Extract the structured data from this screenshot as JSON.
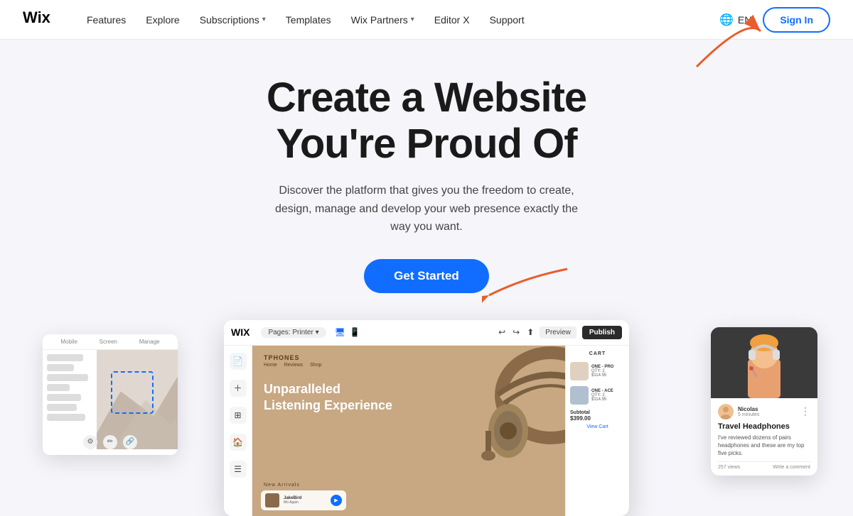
{
  "nav": {
    "logo_text": "Wix",
    "links": [
      {
        "label": "Features",
        "has_dropdown": false
      },
      {
        "label": "Explore",
        "has_dropdown": false
      },
      {
        "label": "Subscriptions",
        "has_dropdown": true
      },
      {
        "label": "Templates",
        "has_dropdown": false
      },
      {
        "label": "Wix Partners",
        "has_dropdown": true
      },
      {
        "label": "Editor X",
        "has_dropdown": false
      },
      {
        "label": "Support",
        "has_dropdown": false
      }
    ],
    "lang": "EN",
    "signin_label": "Sign In"
  },
  "hero": {
    "title_line1": "Create a Website",
    "title_line2": "You're Proud Of",
    "subtitle": "Discover the platform that gives you the freedom to create, design, manage and develop your web presence exactly the way you want.",
    "cta_label": "Get Started"
  },
  "left_card": {
    "columns": [
      "Mobile",
      "Screen",
      "Manage"
    ]
  },
  "editor": {
    "logo": "WIX",
    "page_label": "Pages: Printer ▾",
    "preview_btn": "Preview",
    "publish_btn": "Publish",
    "canvas": {
      "brand": "TPHONES",
      "nav_items": [
        "Home",
        "Reviews",
        "Shop"
      ],
      "headline_line1": "Unparalleled",
      "headline_line2": "Listening Experience",
      "section_label": "New Arrivals",
      "music_title": "JakeBird",
      "music_artist": "Mo Again"
    },
    "cart": {
      "title": "CART",
      "items": [
        {
          "name": "ONE - PRO",
          "variant": "QTY: 2",
          "price": "$114.95"
        },
        {
          "name": "ONE - ACE",
          "variant": "QTY: 2",
          "price": "$114.95"
        }
      ],
      "subtotal_label": "Subtotal",
      "subtotal_amount": "$399.00",
      "view_cart_label": "View Cart"
    }
  },
  "right_card": {
    "user_name": "Nicolas",
    "user_time": "5 minutes",
    "post_title": "Travel Headphones",
    "post_body": "I've reviewed dozens of pairs headphones and these are my top five picks.",
    "views": "257 views",
    "comment_label": "Write a comment"
  },
  "colors": {
    "accent": "#116dff",
    "arrow": "#e85d2b",
    "canvas_bg": "#c8a882",
    "dark": "#2b2b2b"
  }
}
